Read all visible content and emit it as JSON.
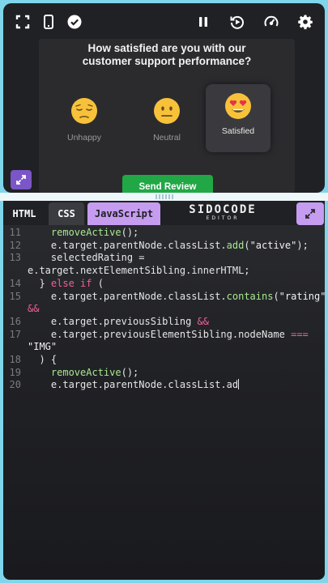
{
  "toolbar": {
    "left_icons": [
      "fullscreen-icon",
      "phone-icon",
      "check-circle-icon"
    ],
    "right_icons": [
      "pause-icon",
      "replay-icon",
      "speed-icon",
      "gear-icon"
    ]
  },
  "preview": {
    "question_line1": "How satisfied are you with our",
    "question_line2": "customer support performance?",
    "ratings": [
      {
        "emoji": "pensive-face",
        "label": "Unhappy",
        "active": false
      },
      {
        "emoji": "neutral-face",
        "label": "Neutral",
        "active": false
      },
      {
        "emoji": "heart-eyes-face",
        "label": "Satisfied",
        "active": true
      }
    ],
    "send_button": "Send Review",
    "accent": "#22a746"
  },
  "editor": {
    "tabs": [
      "HTML",
      "CSS",
      "JavaScript"
    ],
    "active_tab": "JavaScript",
    "brand_name": "SIDOCODE",
    "brand_sub": "EDITOR",
    "lines": [
      {
        "num": "11",
        "code": "    removeActive();"
      },
      {
        "num": "12",
        "code": "    e.target.parentNode.classList.add(\"active\");"
      },
      {
        "num": "13",
        "code": "    selectedRating ="
      },
      {
        "num": "",
        "code": "e.target.nextElementSibling.innerHTML;"
      },
      {
        "num": "14",
        "code": "  } else if ("
      },
      {
        "num": "15",
        "code": "    e.target.parentNode.classList.contains(\"rating\")"
      },
      {
        "num": "",
        "code": "&&"
      },
      {
        "num": "16",
        "code": "    e.target.previousSibling &&"
      },
      {
        "num": "17",
        "code": "    e.target.previousElementSibling.nodeName ==="
      },
      {
        "num": "",
        "code": "\"IMG\""
      },
      {
        "num": "18",
        "code": "  ) {"
      },
      {
        "num": "19",
        "code": "    removeActive();"
      },
      {
        "num": "20",
        "code": "    e.target.parentNode.classList.ad"
      }
    ]
  },
  "colors": {
    "frame": "#7fd6ea",
    "js_tab": "#c59cf0",
    "keyword": "#f0609a"
  }
}
